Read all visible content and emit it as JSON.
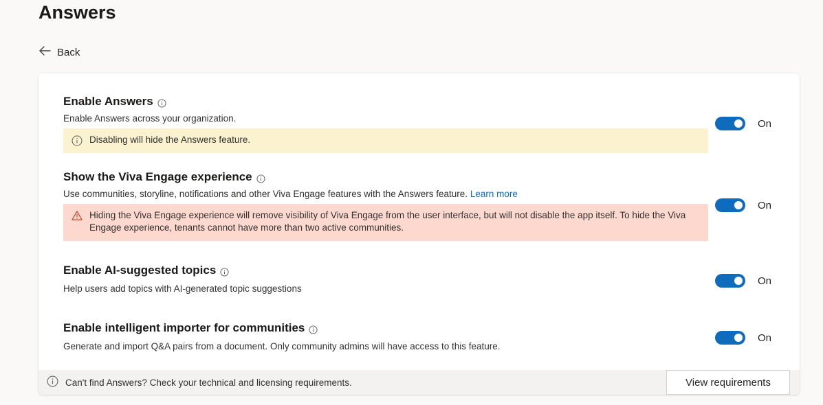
{
  "page": {
    "title": "Answers"
  },
  "back": {
    "label": "Back"
  },
  "settings": [
    {
      "title": "Enable Answers",
      "description": "Enable Answers across your organization.",
      "banner": {
        "type": "info",
        "text": "Disabling will hide the Answers feature."
      },
      "toggle_state": "On"
    },
    {
      "title": "Show the Viva Engage experience",
      "description": "Use communities, storyline, notifications and other Viva Engage features with the Answers feature.",
      "link": "Learn more",
      "banner": {
        "type": "warning",
        "text": "Hiding the Viva Engage experience will remove visibility of Viva Engage from the user interface, but will not disable the app itself. To hide the Viva Engage experience, tenants cannot have more than two active communities."
      },
      "toggle_state": "On"
    },
    {
      "title": "Enable AI-suggested topics",
      "description": "Help users add topics with AI-generated topic suggestions",
      "toggle_state": "On"
    },
    {
      "title": "Enable intelligent importer for communities",
      "description": "Generate and import Q&A pairs from a document. Only community admins will have access to this feature.",
      "toggle_state": "On"
    }
  ],
  "footer": {
    "text": "Can't find Answers? Check your technical and licensing requirements.",
    "button_label": "View requirements"
  },
  "colors": {
    "accent": "#0f6cbd",
    "info_banner": "#fbf3cf",
    "warning_banner": "#fdd8cf",
    "warning_icon": "#c43b1d"
  }
}
